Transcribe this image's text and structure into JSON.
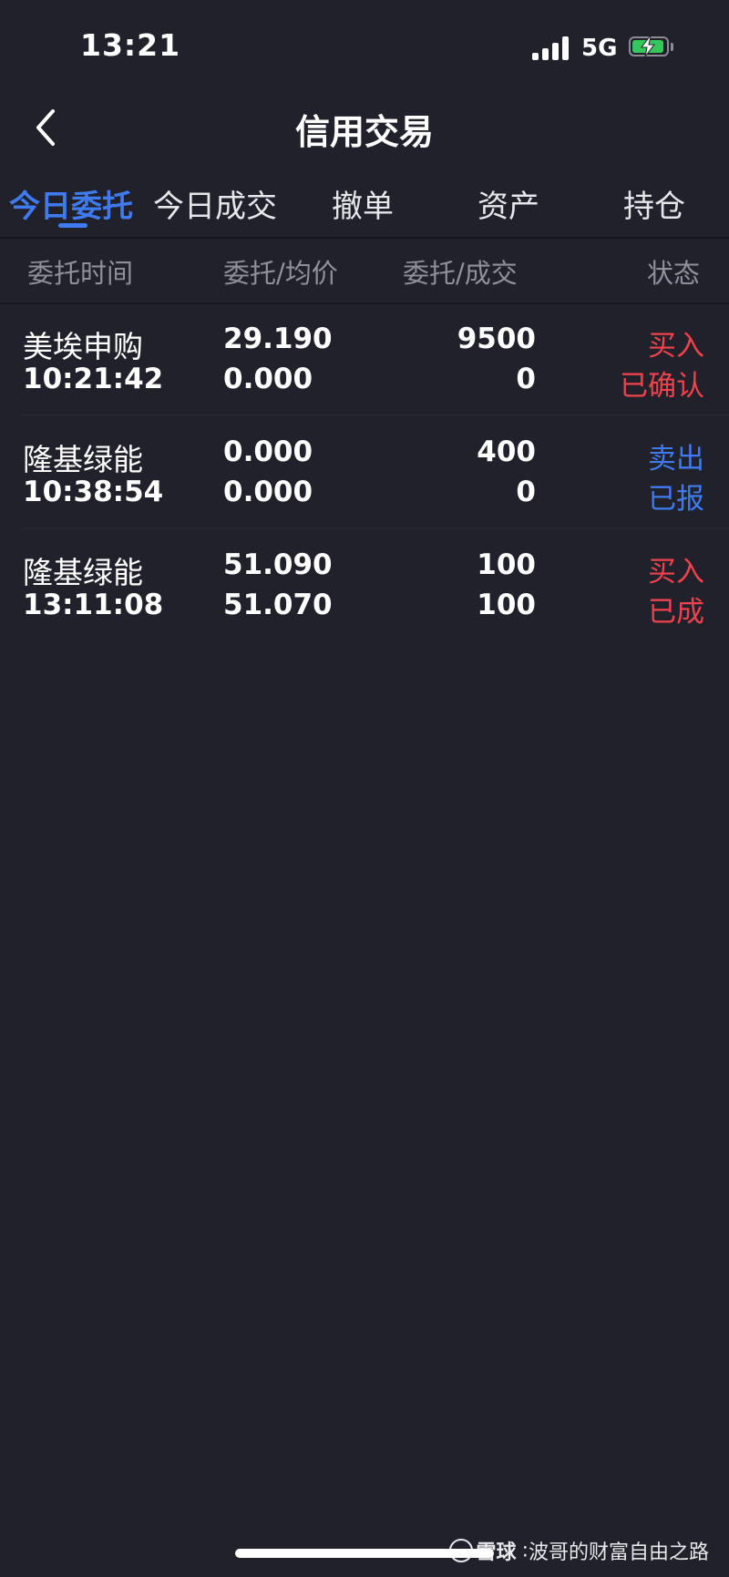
{
  "status_bar": {
    "time": "13:21",
    "network": "5G",
    "battery_icon": "battery-charging-icon",
    "signal_icon": "signal-bars-icon"
  },
  "nav": {
    "title": "信用交易",
    "back_icon": "chevron-left-icon"
  },
  "tabs": [
    {
      "label": "今日委托",
      "active": true
    },
    {
      "label": "今日成交"
    },
    {
      "label": "撤单"
    },
    {
      "label": "资产"
    },
    {
      "label": "持仓"
    }
  ],
  "columns": {
    "time": "委托时间",
    "price": "委托/均价",
    "qty": "委托/成交",
    "status": "状态"
  },
  "orders": [
    {
      "name": "美埃申购",
      "time": "10:21:42",
      "order_price": "29.190",
      "avg_price": "0.000",
      "order_qty": "9500",
      "filled_qty": "0",
      "side": "买入",
      "state": "已确认",
      "side_color": "#f0424c"
    },
    {
      "name": "隆基绿能",
      "time": "10:38:54",
      "order_price": "0.000",
      "avg_price": "0.000",
      "order_qty": "400",
      "filled_qty": "0",
      "side": "卖出",
      "state": "已报",
      "side_color": "#3f7bef"
    },
    {
      "name": "隆基绿能",
      "time": "13:11:08",
      "order_price": "51.090",
      "avg_price": "51.070",
      "order_qty": "100",
      "filled_qty": "100",
      "side": "买入",
      "state": "已成",
      "side_color": "#f0424c"
    }
  ],
  "watermark": {
    "brand": "雪球",
    "separator": ":",
    "author": "波哥的财富自由之路",
    "icon": "snowball-logo-icon"
  },
  "colors": {
    "background": "#20212b",
    "accent": "#3f7bef",
    "buy": "#f0424c",
    "sell": "#3f7bef",
    "muted": "#8e909a"
  }
}
